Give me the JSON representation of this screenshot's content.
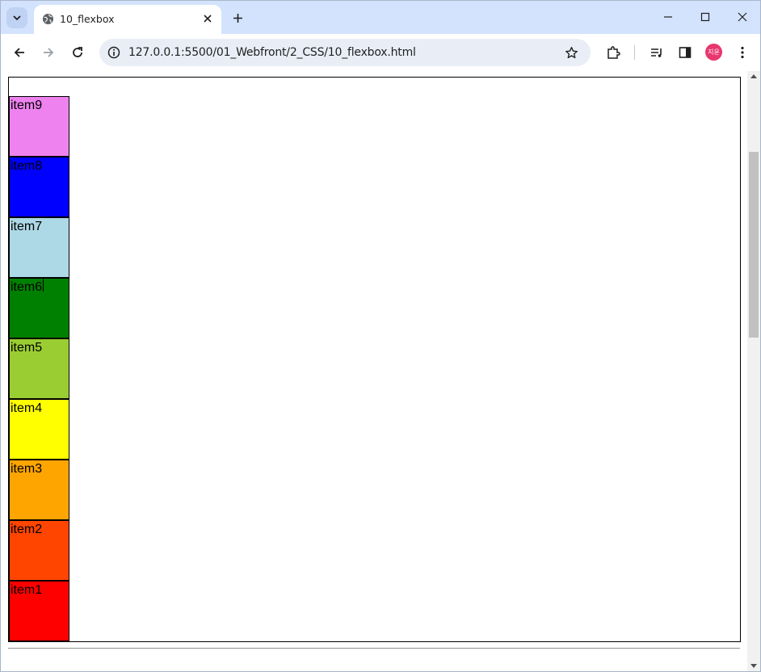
{
  "tab": {
    "title": "10_flexbox"
  },
  "omnibox": {
    "url": "127.0.0.1:5500/01_Webfront/2_CSS/10_flexbox.html"
  },
  "profile": {
    "initials": "지윤",
    "color": "#e8366f"
  },
  "icons": {
    "tab_search": "chevron-down-icon",
    "favicon": "globe-icon",
    "tab_close": "close-icon",
    "new_tab": "plus-icon",
    "minimize": "minimize-icon",
    "maximize": "maximize-icon",
    "close_window": "close-icon",
    "back": "arrow-left-icon",
    "forward": "arrow-right-icon",
    "reload": "reload-icon",
    "site_info": "info-icon",
    "bookmark": "star-icon",
    "extensions": "puzzle-icon",
    "media": "media-control-icon",
    "side_panel": "side-panel-icon",
    "menu": "more-vert-icon"
  },
  "flex_items": [
    {
      "label": "item1",
      "color": "#ff0000"
    },
    {
      "label": "item2",
      "color": "#ff4500"
    },
    {
      "label": "item3",
      "color": "#ffa500"
    },
    {
      "label": "item4",
      "color": "#ffff00"
    },
    {
      "label": "item5",
      "color": "#9acd32"
    },
    {
      "label": "item6",
      "color": "#008000"
    },
    {
      "label": "item7",
      "color": "#add8e6"
    },
    {
      "label": "item8",
      "color": "#0000ff"
    },
    {
      "label": "item9",
      "color": "#ee82ee"
    }
  ]
}
